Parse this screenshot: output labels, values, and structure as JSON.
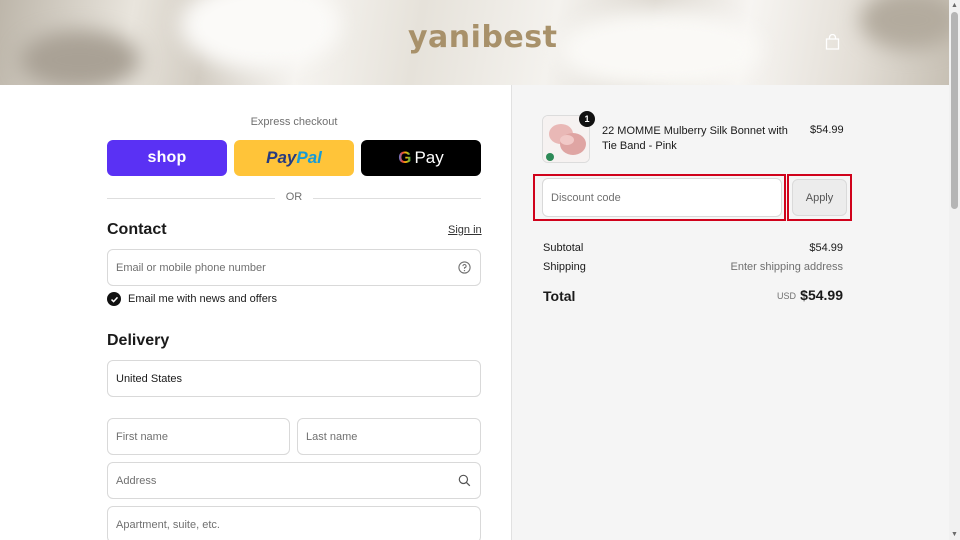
{
  "header": {
    "logo": "yanibest",
    "cart_icon": "shopping-bag-icon"
  },
  "express": {
    "label": "Express checkout",
    "shop_label": "shop",
    "paypal_part1": "Pay",
    "paypal_part2": "Pal",
    "gpay_g": "G",
    "gpay_label": "Pay",
    "or_label": "OR"
  },
  "contact": {
    "title": "Contact",
    "signin_label": "Sign in",
    "email_placeholder": "Email or mobile phone number",
    "help_icon": "question-circle-icon",
    "news_checkbox_label": "Email me with news and offers",
    "news_checked": true
  },
  "delivery": {
    "title": "Delivery",
    "country_value": "United States",
    "first_name_placeholder": "First name",
    "last_name_placeholder": "Last name",
    "address_placeholder": "Address",
    "address_icon": "search-icon",
    "apartment_placeholder": "Apartment, suite, etc."
  },
  "order": {
    "product_name": "22 MOMME Mulberry Silk Bonnet with Tie Band - Pink",
    "product_price": "$54.99",
    "quantity": "1",
    "discount_placeholder": "Discount code",
    "apply_label": "Apply",
    "subtotal_label": "Subtotal",
    "subtotal_value": "$54.99",
    "shipping_label": "Shipping",
    "shipping_value": "Enter shipping address",
    "total_label": "Total",
    "total_currency": "USD",
    "total_value": "$54.99"
  },
  "colors": {
    "shop_purple": "#5a31f4",
    "paypal_yellow": "#ffc439",
    "gpay_black": "#000000",
    "highlight_red": "#d0021b",
    "logo_gold": "#a8916a"
  }
}
